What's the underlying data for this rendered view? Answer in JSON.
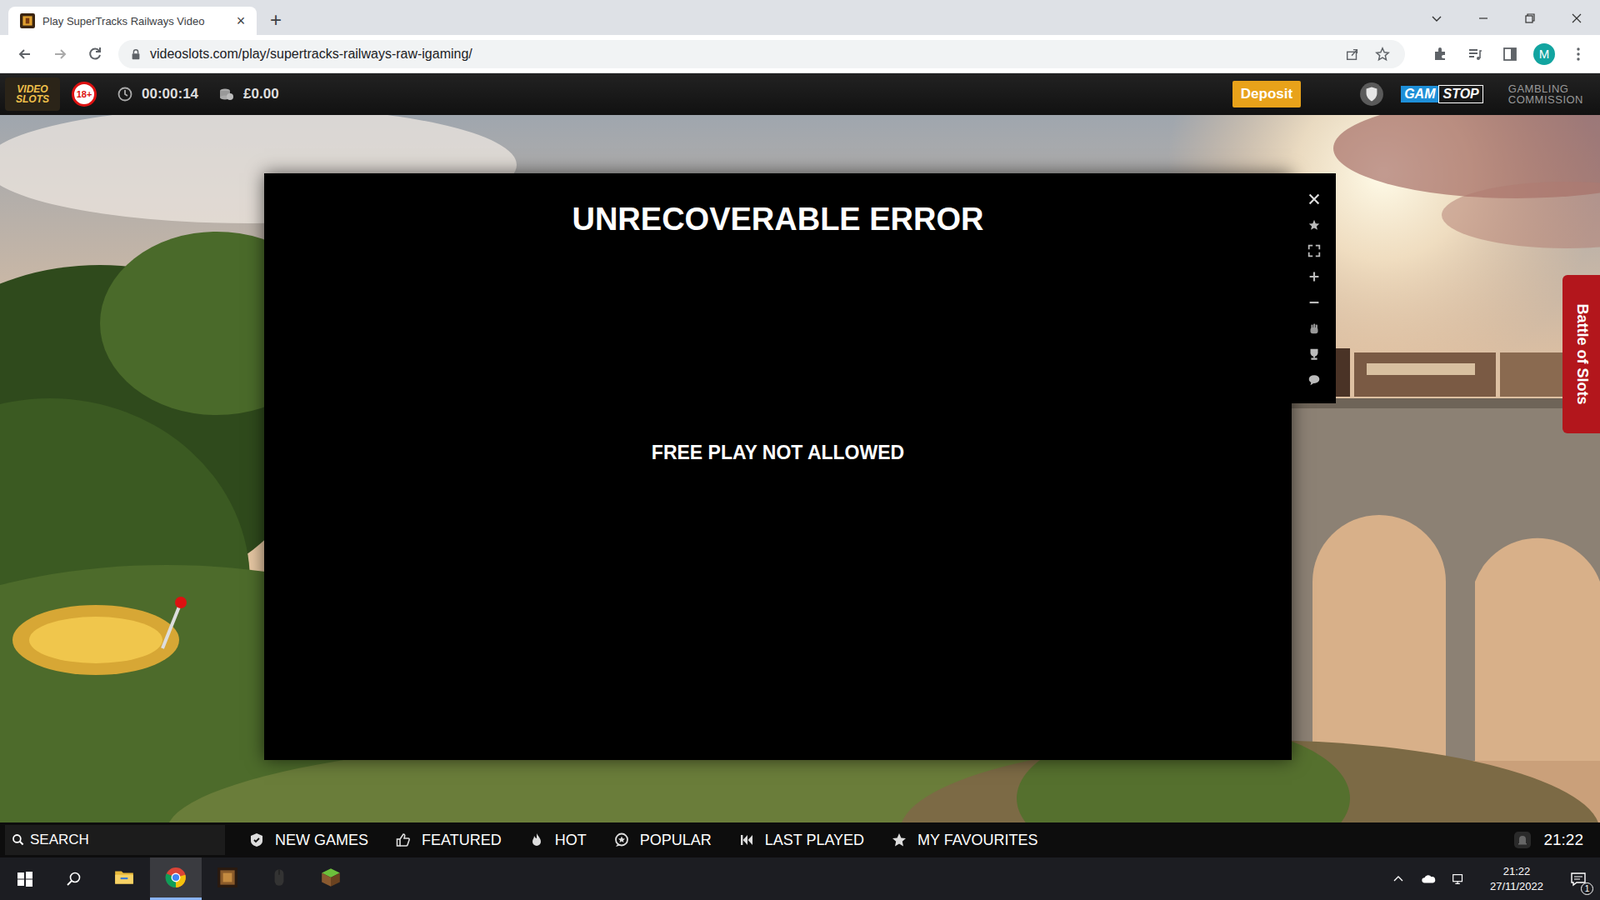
{
  "browser": {
    "tabs": [
      {
        "title": "Play SuperTracks Railways Video",
        "close": "×",
        "selected": true
      }
    ],
    "new_tab": "+",
    "url": "videoslots.com/play/supertracks-railways-raw-igaming/",
    "profile": "M"
  },
  "site_header": {
    "logo": [
      "VIDEO",
      "SLOTS"
    ],
    "age_badge": "18+",
    "session_time": "00:00:14",
    "balance": "£0.00",
    "deposit_button": "Deposit",
    "gamstop": [
      "GAM",
      "STOP"
    ],
    "regulator": [
      "GAMBLING",
      "COMMISSION"
    ]
  },
  "game_modal": {
    "title": "UNRECOVERABLE ERROR",
    "message": "FREE PLAY NOT ALLOWED"
  },
  "side_tab": "Battle of Slots",
  "bottom_nav": {
    "search_placeholder": "SEARCH",
    "items": [
      {
        "label": "NEW GAMES"
      },
      {
        "label": "FEATURED"
      },
      {
        "label": "HOT"
      },
      {
        "label": "POPULAR"
      },
      {
        "label": "LAST PLAYED"
      },
      {
        "label": "MY FAVOURITES"
      }
    ],
    "clock": "21:22"
  },
  "taskbar": {
    "apps": [
      {
        "selected": false
      },
      {
        "selected": true
      },
      {
        "selected": false
      },
      {
        "selected": false
      },
      {
        "selected": false
      }
    ],
    "time": "21:22",
    "date": "27/11/2022",
    "notifications": "1"
  }
}
